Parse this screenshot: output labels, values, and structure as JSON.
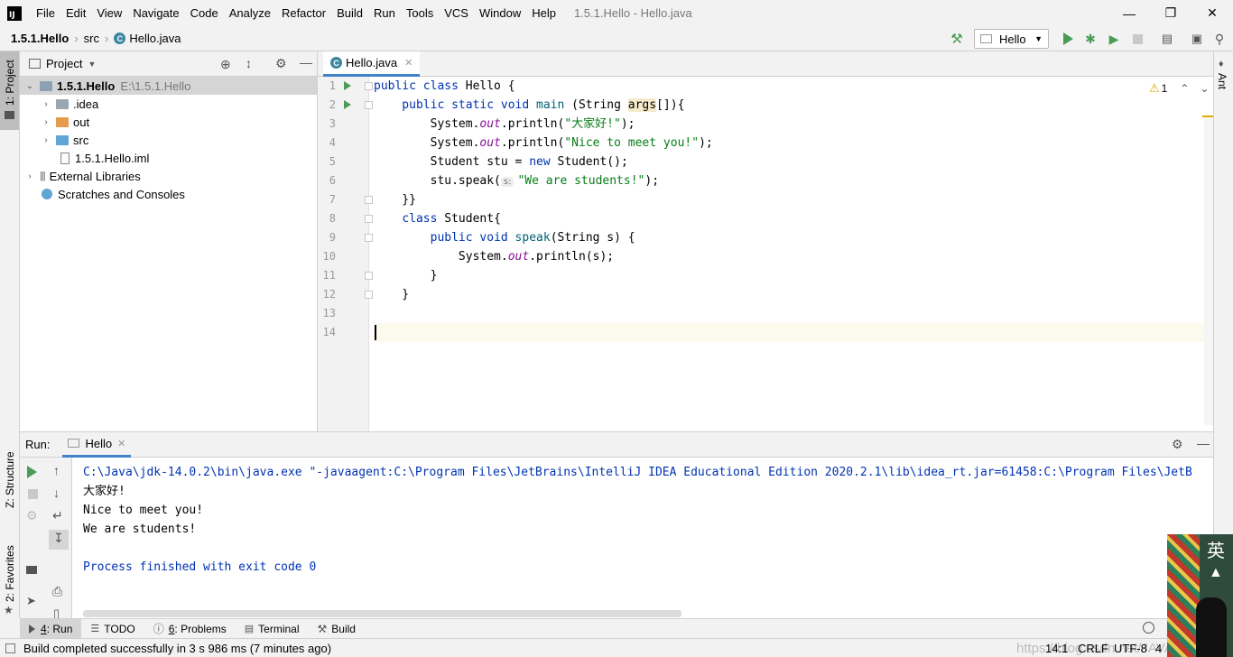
{
  "menu": [
    "File",
    "Edit",
    "View",
    "Navigate",
    "Code",
    "Analyze",
    "Refactor",
    "Build",
    "Run",
    "Tools",
    "VCS",
    "Window",
    "Help"
  ],
  "window_title": "1.5.1.Hello - Hello.java",
  "breadcrumb": {
    "project": "1.5.1.Hello",
    "folder": "src",
    "file": "Hello.java"
  },
  "run_config": "Hello",
  "project_panel": {
    "title": "Project",
    "root_name": "1.5.1.Hello",
    "root_path": "E:\\1.5.1.Hello",
    "items": [
      ".idea",
      "out",
      "src",
      "1.5.1.Hello.iml"
    ],
    "external": "External Libraries",
    "scratches": "Scratches and Consoles"
  },
  "editor": {
    "tab": "Hello.java",
    "warning_count": "1",
    "param_hint": "s:",
    "code": {
      "l1_a": "public class ",
      "l1_b": "Hello {",
      "l2_a": "    public static void ",
      "l2_b": "main",
      " l2_c": " (String ",
      "l2_d": "args",
      "l2_e": "[]){",
      "l3_a": "        System.",
      "l3_b": "out",
      "l3_c": ".println(",
      "l3_d": "\"大家好!\"",
      "l3_e": ");",
      "l4_d": "\"Nice to meet you!\"",
      "l5_a": "        Student stu = ",
      "l5_b": "new",
      "l5_c": " Student();",
      "l6_a": "        stu.speak(",
      "l6_c": "\"We are students!\"",
      "l6_d": ");",
      "l7": "    }}",
      "l8_a": "    ",
      "l8_b": "class",
      "l8_c": " Student{",
      "l9_a": "        ",
      "l9_b": "public void ",
      "l9_c": "speak",
      "l9_d": "(String s) {",
      "l10_a": "            System.",
      "l10_b": "out",
      "l10_c": ".println(s);",
      "l11": "        }",
      "l12": "    }"
    },
    "line_numbers": [
      "1",
      "2",
      "3",
      "4",
      "5",
      "6",
      "7",
      "8",
      "9",
      "10",
      "11",
      "12",
      "13",
      "14"
    ]
  },
  "run_panel": {
    "label": "Run:",
    "tab": "Hello",
    "output": [
      "C:\\Java\\jdk-14.0.2\\bin\\java.exe \"-javaagent:C:\\Program Files\\JetBrains\\IntelliJ IDEA Educational Edition 2020.2.1\\lib\\idea_rt.jar=61458:C:\\Program Files\\JetB",
      "大家好!",
      "Nice to meet you!",
      "We are students!",
      "",
      "Process finished with exit code 0"
    ]
  },
  "left_tabs": {
    "project": "1: Project",
    "structure": "Z: Structure",
    "favorites": "2: Favorites"
  },
  "right_tabs": {
    "ant": "Ant"
  },
  "bottom_tabs": [
    {
      "num": "4",
      "label": ": Run"
    },
    {
      "num": "",
      "label": "TODO"
    },
    {
      "num": "6",
      "label": ": Problems"
    },
    {
      "num": "",
      "label": "Terminal"
    },
    {
      "num": "",
      "label": "Build"
    }
  ],
  "status": {
    "message": "Build completed successfully in 3 s 986 ms (7 minutes ago)",
    "position": "14:1",
    "line_sep": "CRLF",
    "encoding": "UTF-8",
    "indent": "4",
    "watermark": "https://blog.csdn.net/JAVA_Rush",
    "ime": "英"
  },
  "colors": {
    "keyword": "#0033b3",
    "string": "#067d17",
    "static_field": "#871094",
    "method": "#00627a",
    "run_green": "#499c54",
    "accent": "#4083c9"
  }
}
